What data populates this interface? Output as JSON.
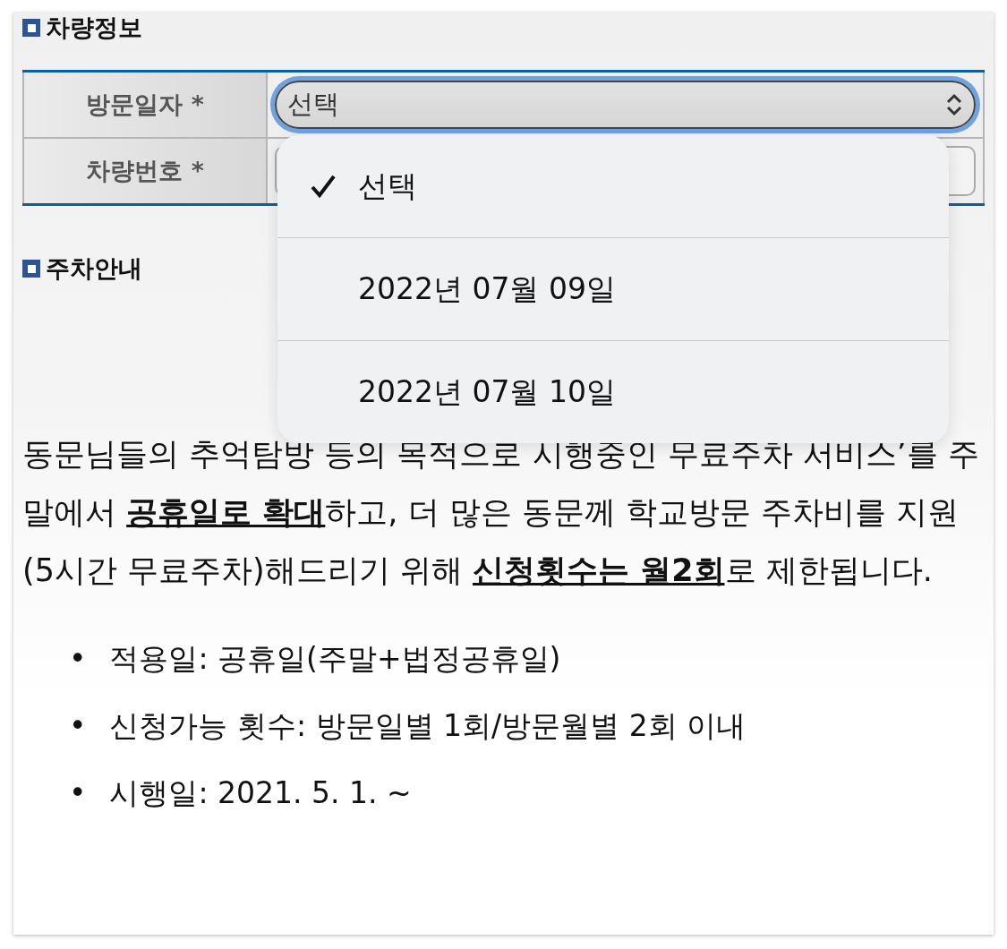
{
  "vehicle_section": {
    "title": "차량정보",
    "fields": [
      {
        "label": "방문일자",
        "required_mark": "*",
        "kind": "select",
        "value": "선택",
        "focused": true
      },
      {
        "label": "차량번호",
        "required_mark": "*",
        "kind": "input"
      }
    ]
  },
  "dropdown": {
    "options": [
      {
        "label": "선택",
        "selected": true
      },
      {
        "label": "2022년 07월 09일",
        "selected": false
      },
      {
        "label": "2022년 07월 10일",
        "selected": false
      }
    ]
  },
  "parking_section": {
    "title": "주차안내",
    "paragraph": "동문님들의 추억탐방 등의 목적으로 시행중인 무료주차 서비스’를 주말에서 **공휴일로 확대**하고, 더 많은 동문께 학교방문 주차비를 지원(5시간 무료주차)해드리기 위해 **신청횟수는 월2회**로 제한됩니다.",
    "bullets": [
      {
        "marker": "•",
        "text": "적용일: 공휴일(주말+법정공휴일)"
      },
      {
        "marker": "•",
        "text": "신청가능 횟수: 방문일별 1회/방문월별 2회 이내"
      },
      {
        "marker": "•",
        "text": "시행일: 2021. 5. 1. ~"
      }
    ]
  }
}
